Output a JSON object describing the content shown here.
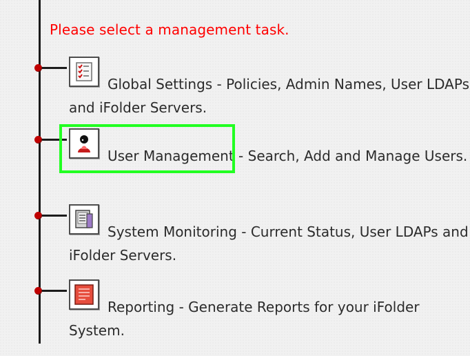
{
  "app": {
    "prompt": "Please select a management task."
  },
  "tasks": [
    {
      "id": "global-settings",
      "label": "Global Settings - Policies, Admin Names, User LDAPs and iFolder Servers.",
      "icon": "checklist-icon"
    },
    {
      "id": "user-management",
      "label": "User Management - Search, Add and Manage Users.",
      "icon": "user-icon"
    },
    {
      "id": "system-monitoring",
      "label": "System Monitoring - Current Status, User LDAPs and iFolder Servers.",
      "icon": "monitor-icon"
    },
    {
      "id": "reporting",
      "label": "Reporting - Generate Reports for your iFolder System.",
      "icon": "report-icon"
    }
  ],
  "colors": {
    "prompt": "#ff0000",
    "dot": "#c00000",
    "highlight": "#22ff22"
  }
}
